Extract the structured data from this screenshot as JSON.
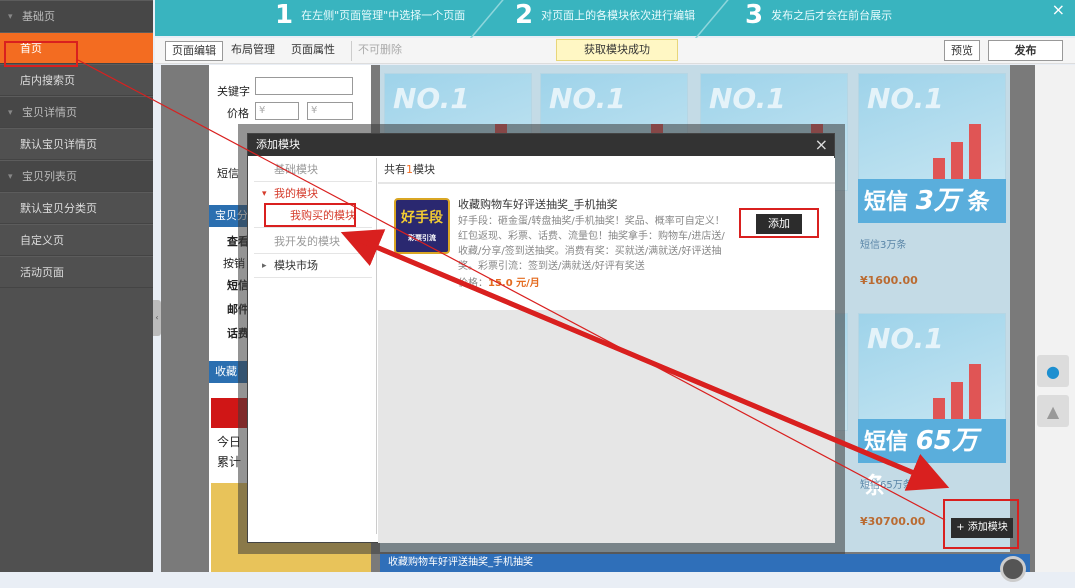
{
  "sidebar": {
    "items": [
      {
        "label": "基础页",
        "kind": "group"
      },
      {
        "label": "首页",
        "kind": "active"
      },
      {
        "label": "店内搜索页",
        "kind": "item"
      },
      {
        "label": "宝贝详情页",
        "kind": "group"
      },
      {
        "label": "默认宝贝详情页",
        "kind": "item"
      },
      {
        "label": "宝贝列表页",
        "kind": "group"
      },
      {
        "label": "默认宝贝分类页",
        "kind": "item"
      },
      {
        "label": "自定义页",
        "kind": "item"
      },
      {
        "label": "活动页面",
        "kind": "item"
      }
    ]
  },
  "topbar": {
    "steps": [
      {
        "num": "1",
        "text": "在左侧\"页面管理\"中选择一个页面"
      },
      {
        "num": "2",
        "text": "对页面上的各模块依次进行编辑"
      },
      {
        "num": "3",
        "text": "发布之后才会在前台展示"
      }
    ],
    "close": "×"
  },
  "toolbar": {
    "page_edit": "页面编辑",
    "layout": "布局管理",
    "page_props": "页面属性",
    "delete": "不可删除",
    "notice": "获取模块成功",
    "preview": "预览",
    "publish": "发布"
  },
  "left_panel": {
    "keyword_label": "关键字",
    "price_label": "价格",
    "currency": "¥",
    "sms_label": "短信",
    "blue_header": "宝贝分",
    "rows": [
      "查看",
      "按销",
      "短信",
      "邮件",
      "话费"
    ],
    "favorites": "收藏",
    "today": "今日",
    "total": "累计"
  },
  "products": {
    "tile_text": "NO.1",
    "banners": [
      {
        "prefix": "短信",
        "num": "3万",
        "suffix": "条"
      },
      {
        "prefix": "短信",
        "num": "65万",
        "suffix": "条"
      }
    ],
    "labels": [
      "短信3万条",
      "短信65万条"
    ],
    "prices": [
      "¥1600.00",
      "¥30700.00"
    ]
  },
  "bottom_bar": "收藏购物车好评送抽奖_手机抽奖",
  "add_module_button": "+ 添加模块",
  "modal": {
    "title": "添加模块",
    "close": "×",
    "nav": {
      "basic": "基础模块",
      "mine": "我的模块",
      "purchased": "我购买的模块",
      "developed": "我开发的模块",
      "market": "模块市场"
    },
    "count_prefix": "共有",
    "count": "1",
    "count_suffix": "模块",
    "module": {
      "thumb_text": "好手段",
      "thumb_tag": "彩票引流",
      "title": "收藏购物车好评送抽奖_手机抽奖",
      "desc": "好手段：砸金蛋/转盘抽奖/手机抽奖！奖品、概率可自定义！红包返现、彩票、话费、流量包！抽奖拿手：购物车/进店送/收藏/分享/签到送抽奖。消费有奖：买就送/满就送/好评送抽奖。彩票引流：签到送/满就送/好评有奖送",
      "price_label": "价格：",
      "price": "15.0 元/月",
      "add_label": "添加"
    }
  },
  "colors": {
    "accent_orange": "#f36c21",
    "annotation_red": "#d9201f",
    "teal": "#39b4bf"
  }
}
